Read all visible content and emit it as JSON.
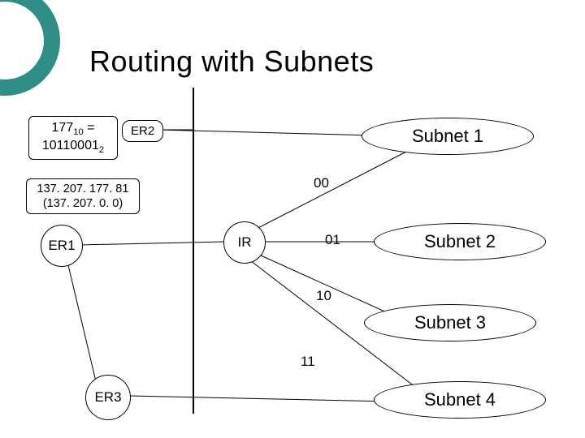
{
  "title": "Routing with Subnets",
  "decimal_box": {
    "dec_value": "177",
    "dec_base": "10",
    "eq": " = ",
    "bin_value": "10110001",
    "bin_base": "2"
  },
  "er2": "ER2",
  "ip_box": {
    "line1": "137. 207. 177. 81",
    "line2": "(137. 207. 0. 0)"
  },
  "er1": "ER1",
  "ir": "IR",
  "er3": "ER3",
  "bits": {
    "b00": "00",
    "b01": "01",
    "b10": "10",
    "b11": "11"
  },
  "subnets": {
    "s1": "Subnet 1",
    "s2": "Subnet 2",
    "s3": "Subnet 3",
    "s4": "Subnet 4"
  }
}
